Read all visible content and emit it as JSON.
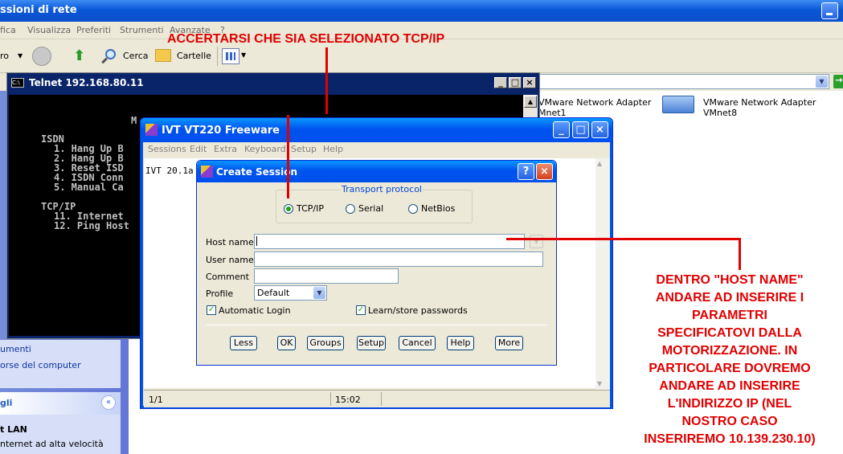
{
  "explorer": {
    "title": "ssioni di rete",
    "menu": [
      "fica",
      "Visualizza",
      "Preferiti",
      "Strumenti",
      "Avanzate",
      "?"
    ],
    "toolbar": {
      "back": "ro",
      "search": "Cerca",
      "folders": "Cartelle"
    },
    "items": [
      {
        "label": "VMware Network Adapter",
        "sub": "Mnet1"
      },
      {
        "label": "VMware Network Adapter",
        "sub": "VMnet8"
      }
    ],
    "left": {
      "task1": "umenti",
      "task2": "orse del computer",
      "panel_title": "gli",
      "lan_title": "t LAN",
      "lan_sub": "nternet ad alta velocità"
    }
  },
  "telnet": {
    "title": "Telnet 192.168.80.11",
    "lines": {
      "m": "M",
      "isdn": "ISDN",
      "i1": "1.  Hang Up B",
      "i2": "2.  Hang Up B",
      "i3": "3.  Reset ISD",
      "i4": "4.  ISDN Conn",
      "i5": "5.  Manual Ca",
      "tcpip": "TCP/IP",
      "t11": "11. Internet",
      "t12": "12. Ping Host"
    }
  },
  "ivt": {
    "title": "IVT VT220 Freeware",
    "menu": [
      "Sessions",
      "Edit",
      "Extra",
      "Keyboard",
      "Setup",
      "Help"
    ],
    "screen_text": "IVT 20.1a",
    "status": {
      "page": "1/1",
      "time": "15:02"
    }
  },
  "dialog": {
    "title": "Create Session",
    "group_label": "Transport protocol",
    "protocols": [
      {
        "label": "TCP/IP",
        "selected": true
      },
      {
        "label": "Serial",
        "selected": false
      },
      {
        "label": "NetBios",
        "selected": false
      }
    ],
    "host_name_label": "Host name",
    "host_name_value": "",
    "user_name_label": "User name",
    "comment_label": "Comment",
    "profile_label": "Profile",
    "profile_value": "Default",
    "auto_login_label": "Automatic Login",
    "learn_label": "Learn/store passwords",
    "buttons": [
      "Less",
      "OK",
      "Groups",
      "Setup",
      "Cancel",
      "Help",
      "More"
    ]
  },
  "annotations": {
    "top": "ACCERTARSI CHE SIA SELEZIONATO TCP/IP",
    "right": [
      "DENTRO \"HOST NAME\"",
      "ANDARE AD INSERIRE I",
      "PARAMETRI",
      "SPECIFICATOVI DALLA",
      "MOTORIZZAZIONE. IN",
      "PARTICOLARE DOVREMO",
      "ANDARE AD INSERIRE",
      "L'INDIRIZZO IP (NEL",
      "NOSTRO CASO",
      "INSERIREMO 10.139.230.10)"
    ]
  }
}
